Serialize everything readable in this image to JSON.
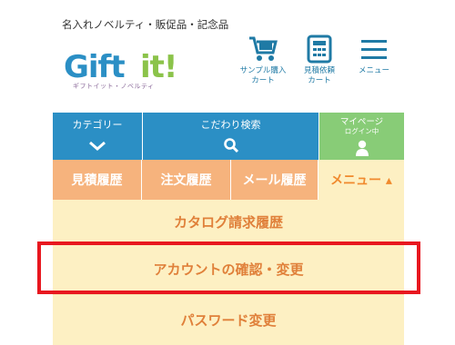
{
  "header": {
    "tagline": "名入れノベルティ・販促品・記念品",
    "logo_text": "Gift it!",
    "logo_sub": "ギフトイット・ノベルティ",
    "sample_cart_label_1": "サンプル購入",
    "sample_cart_label_2": "カート",
    "quote_cart_label_1": "見積依頼",
    "quote_cart_label_2": "カート",
    "menu_label": "メニュー"
  },
  "nav": {
    "category": "カテゴリー",
    "search": "こだわり検索",
    "mypage": "マイページ",
    "mypage_status": "ログイン中"
  },
  "tabs": {
    "quotes": "見積履歴",
    "orders": "注文履歴",
    "mail": "メール履歴",
    "menu": "メニュー ▴"
  },
  "menu_items": [
    {
      "label": "カタログ請求履歴"
    },
    {
      "label": "アカウントの確認・変更"
    },
    {
      "label": "パスワード変更"
    }
  ],
  "colors": {
    "nav_blue": "#2b8fc5",
    "nav_green": "#88cc77",
    "tab_orange": "#f6b37d",
    "menu_bg": "#fdf0c3",
    "menu_text": "#e0803a",
    "highlight": "#e8171f"
  }
}
